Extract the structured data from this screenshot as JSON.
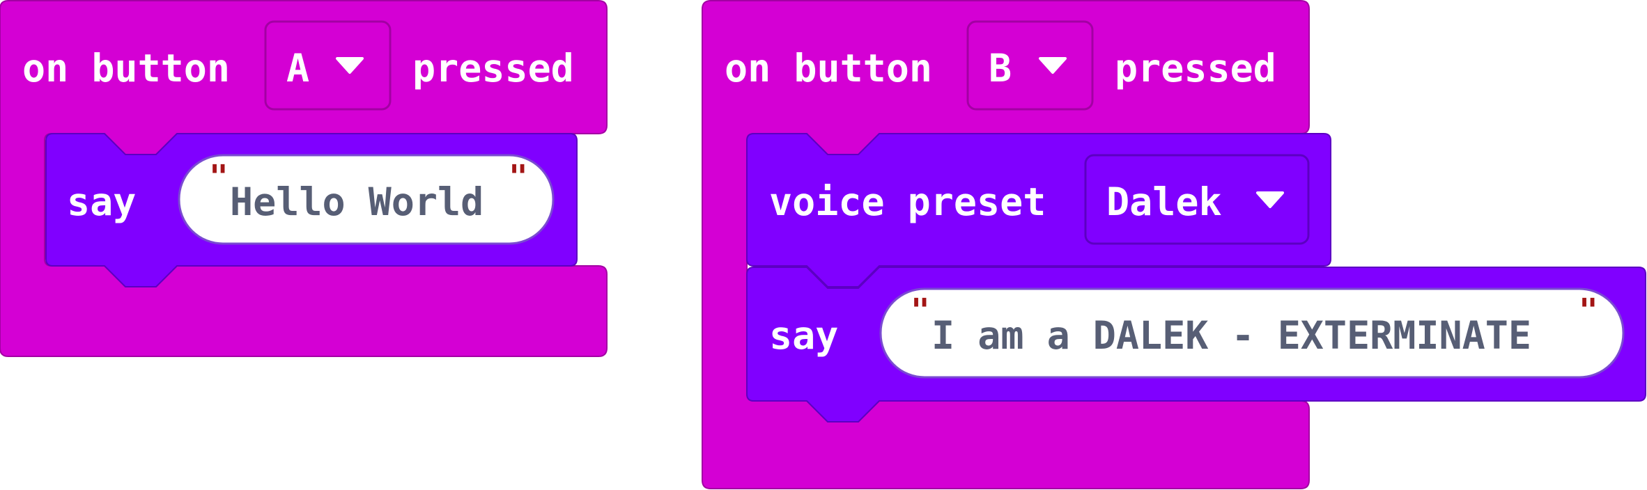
{
  "colors": {
    "event_block": "#d400d4",
    "event_block_border": "#a300a3",
    "music_block": "#8000ff",
    "music_block_border": "#5c00c2",
    "string_text": "#575e75",
    "quote_mark": "#a31515"
  },
  "blocks": [
    {
      "hat": {
        "prefix": "on button",
        "dropdown_value": "A",
        "suffix": "pressed"
      },
      "statements": [
        {
          "label": "say",
          "quote_open": "\"",
          "text": "Hello World",
          "quote_close": "\""
        }
      ]
    },
    {
      "hat": {
        "prefix": "on button",
        "dropdown_value": "B",
        "suffix": "pressed"
      },
      "statements": [
        {
          "label": "voice preset",
          "dropdown_value": "Dalek"
        },
        {
          "label": "say",
          "quote_open": "\"",
          "text": "I am a DALEK - EXTERMINATE",
          "quote_close": "\""
        }
      ]
    }
  ]
}
